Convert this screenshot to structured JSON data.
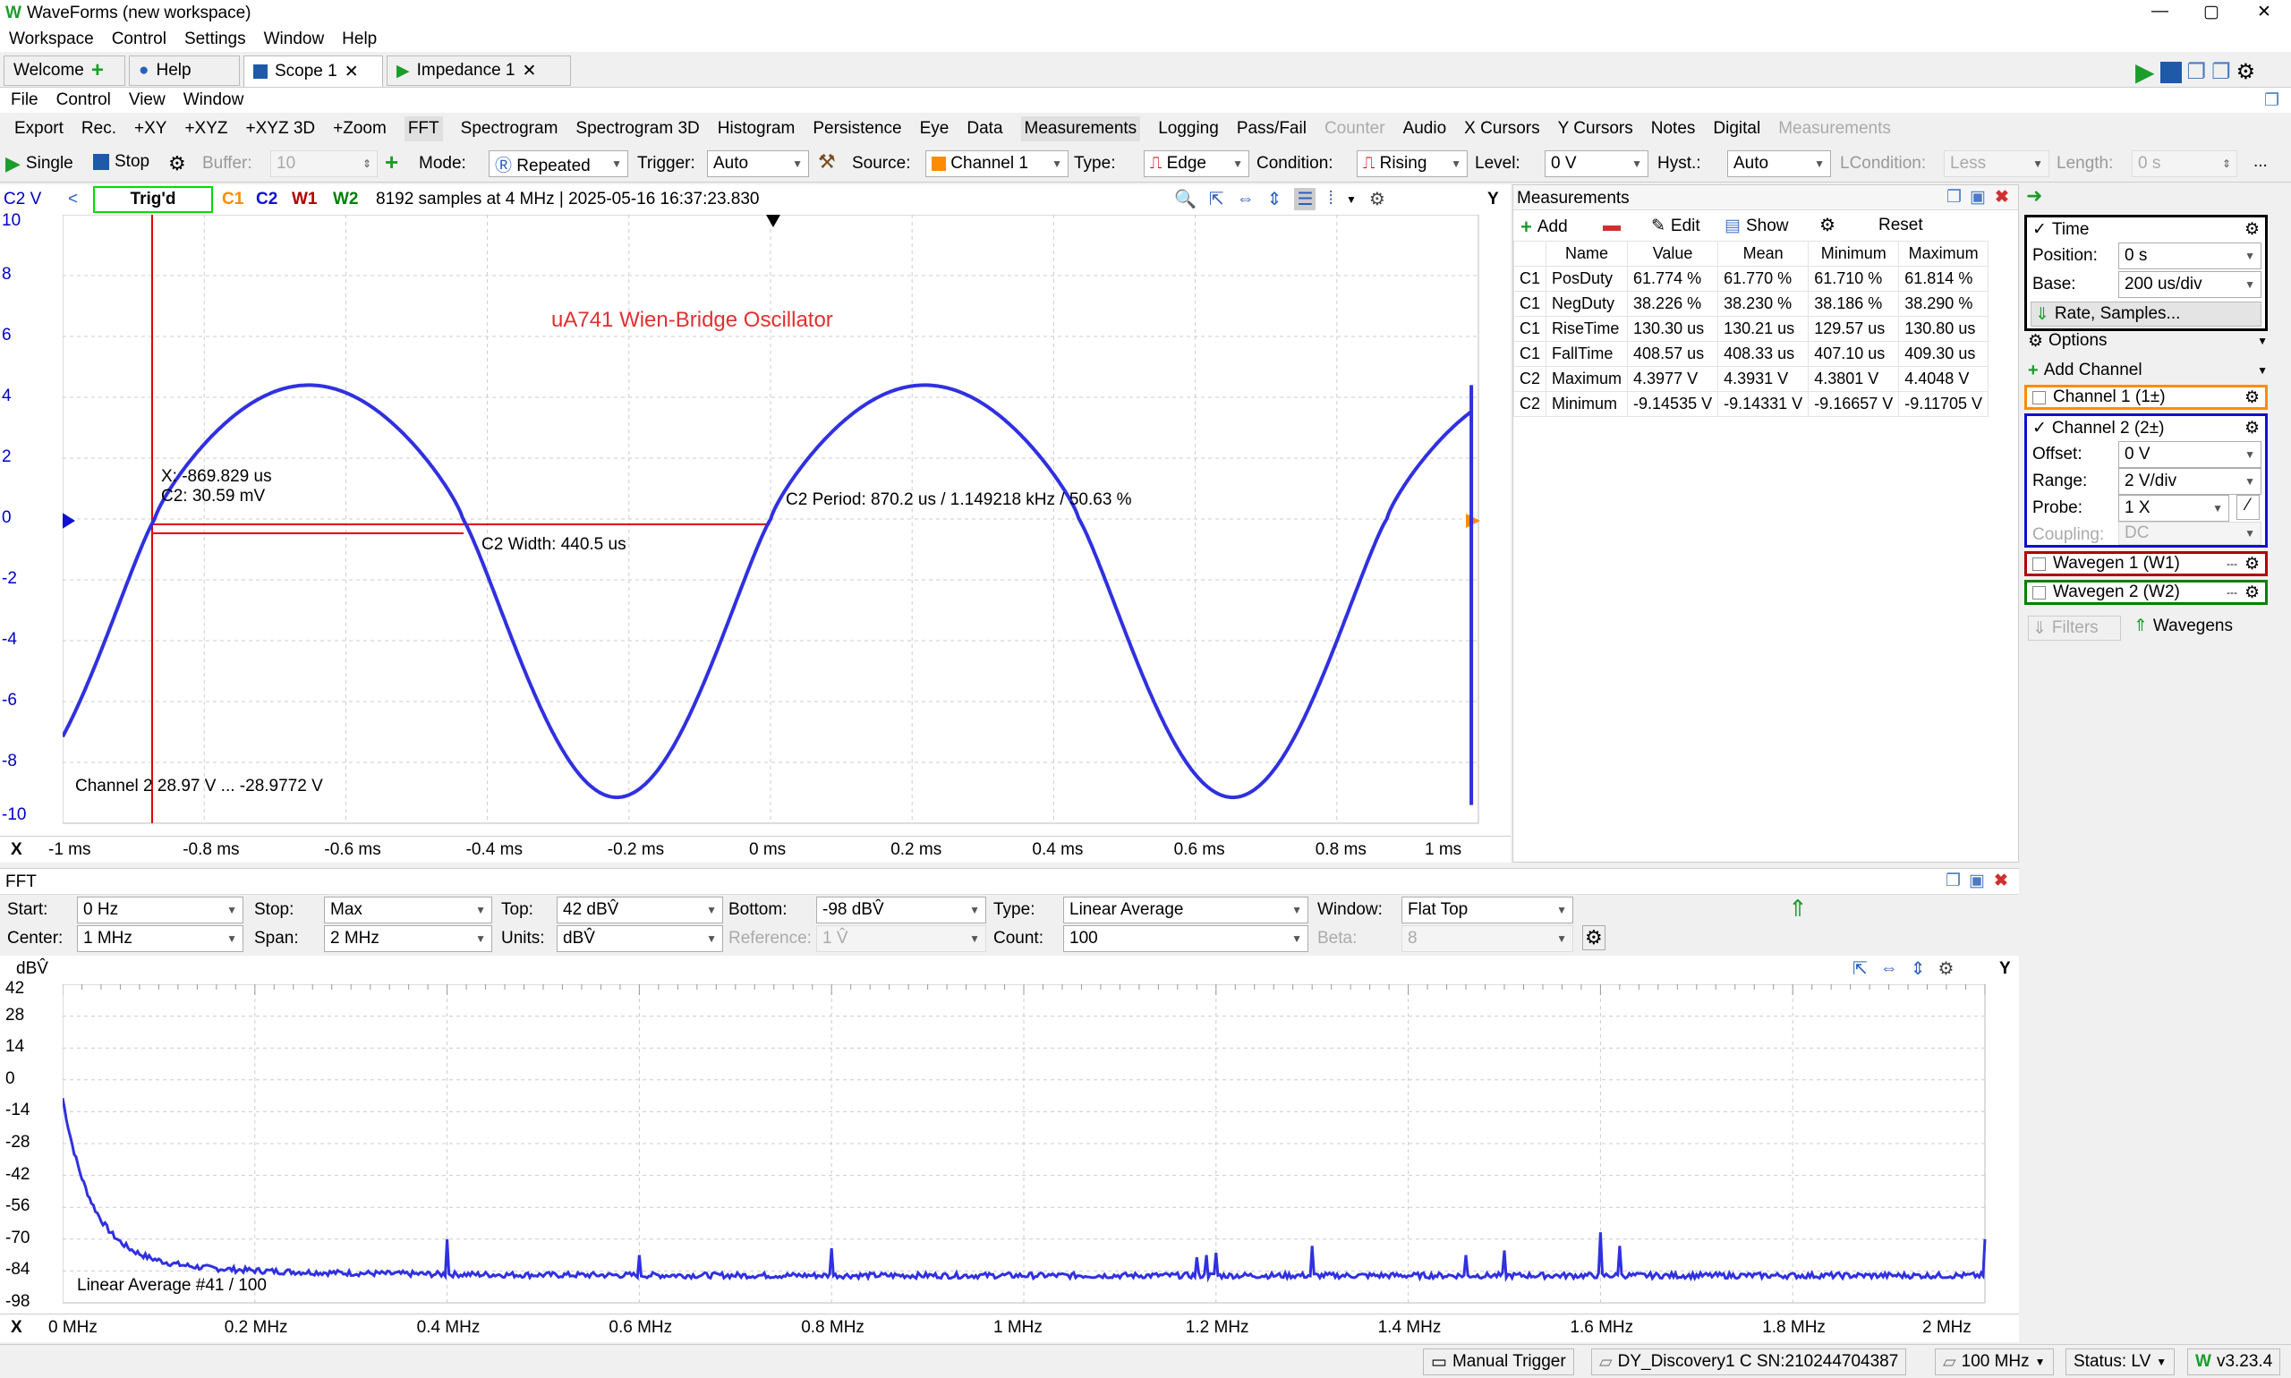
{
  "window": {
    "title": "WaveForms (new workspace)"
  },
  "menubar": [
    "Workspace",
    "Control",
    "Settings",
    "Window",
    "Help"
  ],
  "tabs": [
    {
      "label": "Welcome",
      "active": false
    },
    {
      "label": "Help",
      "active": false
    },
    {
      "label": "Scope 1",
      "active": true
    },
    {
      "label": "Impedance 1",
      "active": false
    }
  ],
  "scope_menu": [
    "File",
    "Control",
    "View",
    "Window"
  ],
  "toolbar1": [
    "Export",
    "Rec.",
    "+XY",
    "+XYZ",
    "+XYZ 3D",
    "+Zoom",
    "FFT",
    "Spectrogram",
    "Spectrogram 3D",
    "Histogram",
    "Persistence",
    "Eye",
    "Data",
    "Measurements",
    "Logging",
    "Pass/Fail",
    "Counter",
    "Audio",
    "X Cursors",
    "Y Cursors",
    "Notes",
    "Digital",
    "Measurements"
  ],
  "toolbar2": {
    "single": "Single",
    "stop": "Stop",
    "buffer_label": "Buffer:",
    "buffer_value": "10",
    "mode_label": "Mode:",
    "mode_value": "Repeated",
    "trigger_label": "Trigger:",
    "trigger_value": "Auto",
    "source_label": "Source:",
    "source_value": "Channel 1",
    "type_label": "Type:",
    "type_value": "Edge",
    "condition_label": "Condition:",
    "condition_value": "Rising",
    "level_label": "Level:",
    "level_value": "0 V",
    "hyst_label": "Hyst.:",
    "hyst_value": "Auto",
    "lcondition_label": "LCondition:",
    "lcondition_value": "Less",
    "length_label": "Length:",
    "length_value": "0 s",
    "more": "..."
  },
  "scope": {
    "y_unit": "C2 V",
    "status": "Trig'd",
    "channels": [
      {
        "name": "C1",
        "color": "#ff8c00"
      },
      {
        "name": "C2",
        "color": "#1010d0"
      },
      {
        "name": "W1",
        "color": "#b00000"
      },
      {
        "name": "W2",
        "color": "#008000"
      }
    ],
    "info": "8192 samples at 4 MHz  | 2025-05-16 16:37:23.830",
    "y_ticks": [
      "10",
      "8",
      "6",
      "4",
      "2",
      "0",
      "-2",
      "-4",
      "-6",
      "-8",
      "-10"
    ],
    "x_ticks": [
      "-1 ms",
      "-0.8 ms",
      "-0.6 ms",
      "-0.4 ms",
      "-0.2 ms",
      "0 ms",
      "0.2 ms",
      "0.4 ms",
      "0.6 ms",
      "0.8 ms",
      "1 ms"
    ],
    "x_label": "X",
    "y_label": "Y",
    "annotation": "uA741 Wien-Bridge Oscillator",
    "cursor_x": "X: -869.829 us",
    "cursor_c2": "C2: 30.59 mV",
    "period_label": "C2 Period: 870.2 us / 1.149218 kHz / 50.63 %",
    "width_label": "C2 Width: 440.5 us",
    "range_label": "Channel 2  28.97 V ... -28.9772 V"
  },
  "measurements": {
    "title": "Measurements",
    "buttons": [
      "Add",
      "Edit",
      "Show",
      "Reset"
    ],
    "headers": [
      "Name",
      "Value",
      "Mean",
      "Minimum",
      "Maximum"
    ],
    "rows": [
      [
        "C1",
        "PosDuty",
        "61.774 %",
        "61.770 %",
        "61.710 %",
        "61.814 %"
      ],
      [
        "C1",
        "NegDuty",
        "38.226 %",
        "38.230 %",
        "38.186 %",
        "38.290 %"
      ],
      [
        "C1",
        "RiseTime",
        "130.30 us",
        "130.21 us",
        "129.57 us",
        "130.80 us"
      ],
      [
        "C1",
        "FallTime",
        "408.57 us",
        "408.33 us",
        "407.10 us",
        "409.30 us"
      ],
      [
        "C2",
        "Maximum",
        "4.3977 V",
        "4.3931 V",
        "4.3801 V",
        "4.4048 V"
      ],
      [
        "C2",
        "Minimum",
        "-9.14535 V",
        "-9.14331 V",
        "-9.16657 V",
        "-9.11705 V"
      ]
    ]
  },
  "right_panel": {
    "time": {
      "title": "Time",
      "position_label": "Position:",
      "position_value": "0 s",
      "base_label": "Base:",
      "base_value": "200 us/div",
      "rate": "Rate, Samples..."
    },
    "options": "Options",
    "add_channel": "Add Channel",
    "channel1": "Channel 1 (1±)",
    "channel2": {
      "title": "Channel 2 (2±)",
      "offset_label": "Offset:",
      "offset_value": "0 V",
      "range_label": "Range:",
      "range_value": "2 V/div",
      "probe_label": "Probe:",
      "probe_value": "1 X",
      "coupling_label": "Coupling:",
      "coupling_value": "DC"
    },
    "wavegen1": "Wavegen 1 (W1)",
    "wavegen2": "Wavegen 2 (W2)",
    "filters": "Filters",
    "wavegens": "Wavegens"
  },
  "fft": {
    "title": "FFT",
    "start_label": "Start:",
    "start_value": "0 Hz",
    "stop_label": "Stop:",
    "stop_value": "Max",
    "top_label": "Top:",
    "top_value": "42 dBV̂",
    "bottom_label": "Bottom:",
    "bottom_value": "-98 dBV̂",
    "type_label": "Type:",
    "type_value": "Linear Average",
    "window_label": "Window:",
    "window_value": "Flat Top",
    "center_label": "Center:",
    "center_value": "1 MHz",
    "span_label": "Span:",
    "span_value": "2 MHz",
    "units_label": "Units:",
    "units_value": "dBV̂",
    "reference_label": "Reference:",
    "reference_value": "1 V̂",
    "count_label": "Count:",
    "count_value": "100",
    "beta_label": "Beta:",
    "beta_value": "8",
    "y_unit": "dBV̂",
    "y_ticks": [
      "42",
      "28",
      "14",
      "0",
      "-14",
      "-28",
      "-42",
      "-56",
      "-70",
      "-84",
      "-98"
    ],
    "x_ticks": [
      "0 MHz",
      "0.2 MHz",
      "0.4 MHz",
      "0.6 MHz",
      "0.8 MHz",
      "1 MHz",
      "1.2 MHz",
      "1.4 MHz",
      "1.6 MHz",
      "1.8 MHz",
      "2 MHz"
    ],
    "x_label": "X",
    "y_label": "Y",
    "average_label": "Linear Average #41 / 100"
  },
  "statusbar": {
    "manual_trigger": "Manual Trigger",
    "device": "DY_Discovery1 C SN:210244704387",
    "clock": "100 MHz",
    "status": "Status: LV",
    "version": "v3.23.4"
  }
}
